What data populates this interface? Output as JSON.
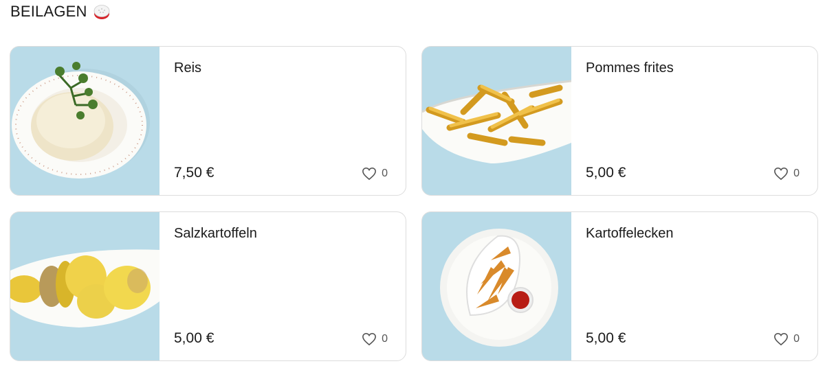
{
  "section": {
    "title": "BEILAGEN",
    "emoji_icon": "rice-ball-icon"
  },
  "items": [
    {
      "name": "Reis",
      "price": "7,50 €",
      "likes": "0",
      "image_icon": "rice-dish-icon"
    },
    {
      "name": "Pommes frites",
      "price": "5,00 €",
      "likes": "0",
      "image_icon": "fries-dish-icon"
    },
    {
      "name": "Salzkartoffeln",
      "price": "5,00 €",
      "likes": "0",
      "image_icon": "boiled-potatoes-dish-icon"
    },
    {
      "name": "Kartoffelecken",
      "price": "5,00 €",
      "likes": "0",
      "image_icon": "potato-wedges-dish-icon"
    }
  ],
  "colors": {
    "image_background": "#b9dbe8",
    "card_border": "#dcdcdc",
    "text": "#1a1a1a",
    "heart": "#555555"
  }
}
